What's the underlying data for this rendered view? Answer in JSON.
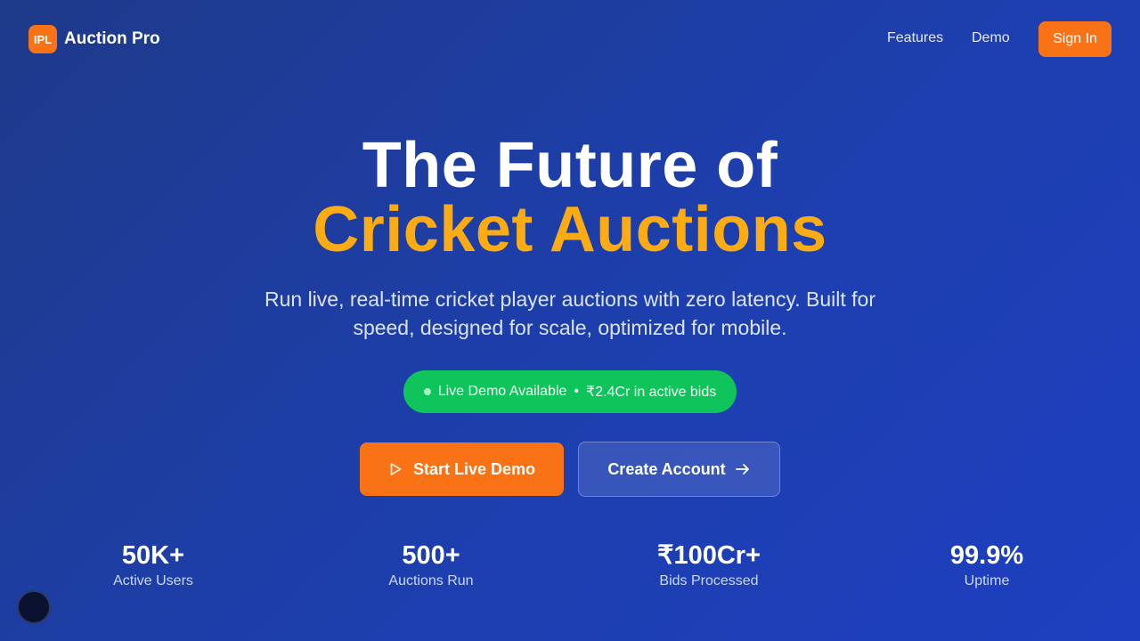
{
  "nav": {
    "logo_badge": "IPL",
    "logo_text": "Auction Pro",
    "links": [
      "Features",
      "Demo"
    ],
    "signin_label": "Sign In"
  },
  "hero": {
    "title_line1": "The Future of",
    "title_line2": "Cricket Auctions",
    "subtitle": "Run live, real-time cricket player auctions with zero latency. Built for speed, designed for scale, optimized for mobile.",
    "pill_status": "Live Demo Available",
    "pill_separator": "•",
    "pill_bids": "₹2.4Cr in active bids"
  },
  "cta": {
    "demo_label": "Start Live Demo",
    "demo_icon": "play-icon",
    "create_label": "Create Account",
    "create_icon": "arrow-right-icon"
  },
  "stats": [
    {
      "value": "50K+",
      "label": "Active Users"
    },
    {
      "value": "500+",
      "label": "Auctions Run"
    },
    {
      "value": "₹100Cr+",
      "label": "Bids Processed"
    },
    {
      "value": "99.9%",
      "label": "Uptime"
    }
  ],
  "colors": {
    "accent_orange": "#f97316",
    "title_highlight": "#fbab13",
    "live_green": "#10c45c",
    "background": "#1e3a8a"
  }
}
